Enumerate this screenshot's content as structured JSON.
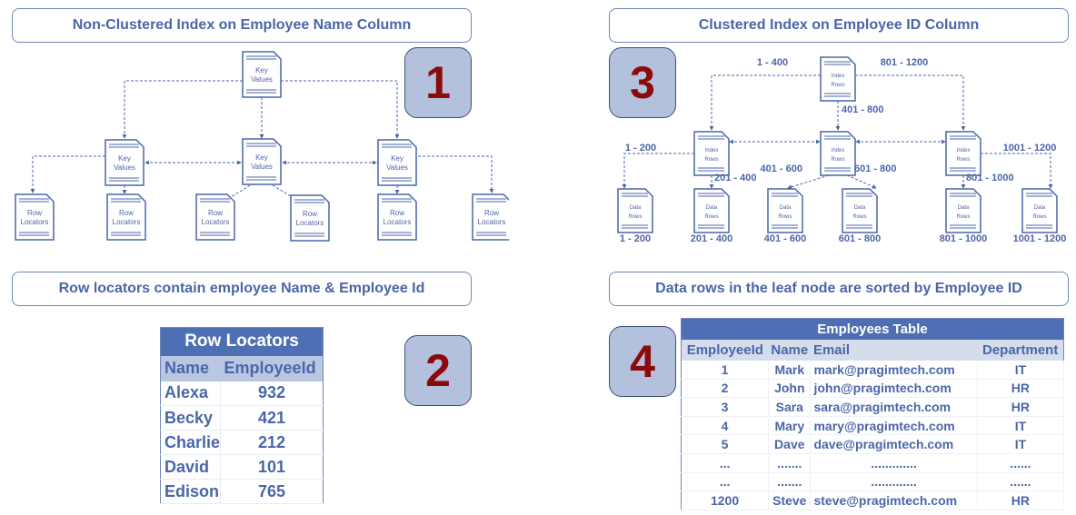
{
  "panel1": {
    "title": "Non-Clustered Index on Employee Name Column",
    "badge": "1",
    "root": {
      "line1": "Key",
      "line2": "Values"
    },
    "mid": [
      {
        "line1": "Key",
        "line2": "Values"
      },
      {
        "line1": "Key",
        "line2": "Values"
      },
      {
        "line1": "Key",
        "line2": "Values"
      }
    ],
    "leaves": [
      {
        "line1": "Row",
        "line2": "Locators"
      },
      {
        "line1": "Row",
        "line2": "Locators"
      },
      {
        "line1": "Row",
        "line2": "Locators"
      },
      {
        "line1": "Row",
        "line2": "Locators"
      },
      {
        "line1": "Row",
        "line2": "Locators"
      },
      {
        "line1": "Row",
        "line2": "Locators"
      }
    ]
  },
  "panel2": {
    "title": "Row locators contain employee Name & Employee Id",
    "badge": "2",
    "table": {
      "caption": "Row Locators",
      "columns": [
        "Name",
        "EmployeeId"
      ],
      "rows": [
        [
          "Alexa",
          "932"
        ],
        [
          "Becky",
          "421"
        ],
        [
          "Charlie",
          "212"
        ],
        [
          "David",
          "101"
        ],
        [
          "Edison",
          "765"
        ]
      ]
    }
  },
  "panel3": {
    "title": "Clustered Index on Employee ID Column",
    "badge": "3",
    "root": {
      "line1": "Index",
      "line2": "Rows"
    },
    "mid": [
      {
        "line1": "Index",
        "line2": "Rows"
      },
      {
        "line1": "Index",
        "line2": "Rows"
      },
      {
        "line1": "Index",
        "line2": "Rows"
      }
    ],
    "leaves": [
      {
        "line1": "Data",
        "line2": "Rows",
        "range": "1 - 200"
      },
      {
        "line1": "Data",
        "line2": "Rows",
        "range": "201 - 400"
      },
      {
        "line1": "Data",
        "line2": "Rows",
        "range": "401 - 600"
      },
      {
        "line1": "Data",
        "line2": "Rows",
        "range": "601 - 800"
      },
      {
        "line1": "Data",
        "line2": "Rows",
        "range": "801 - 1000"
      },
      {
        "line1": "Data",
        "line2": "Rows",
        "range": "1001 - 1200"
      }
    ],
    "edge_labels": {
      "root_left": "1 - 400",
      "root_mid": "401 - 800",
      "root_right": "801 - 1200",
      "l1": "1 - 200",
      "l2": "201 - 400",
      "l3": "401 - 600",
      "l4": "601 - 800",
      "l5": "801 - 1000",
      "l6": "1001 - 1200"
    }
  },
  "panel4": {
    "title": "Data rows in the leaf node are sorted by Employee ID",
    "badge": "4",
    "table": {
      "caption": "Employees Table",
      "columns": [
        "EmployeeId",
        "Name",
        "Email",
        "Department"
      ],
      "rows": [
        [
          "1",
          "Mark",
          "mark@pragimtech.com",
          "IT"
        ],
        [
          "2",
          "John",
          "john@pragimtech.com",
          "HR"
        ],
        [
          "3",
          "Sara",
          "sara@pragimtech.com",
          "HR"
        ],
        [
          "4",
          "Mary",
          "mary@pragimtech.com",
          "IT"
        ],
        [
          "5",
          "Dave",
          "dave@pragimtech.com",
          "IT"
        ],
        [
          "...",
          ".......",
          ".............",
          "......"
        ],
        [
          "...",
          ".......",
          ".............",
          "......"
        ],
        [
          "1200",
          "Steve",
          "steve@pragimtech.com",
          "HR"
        ]
      ]
    }
  }
}
